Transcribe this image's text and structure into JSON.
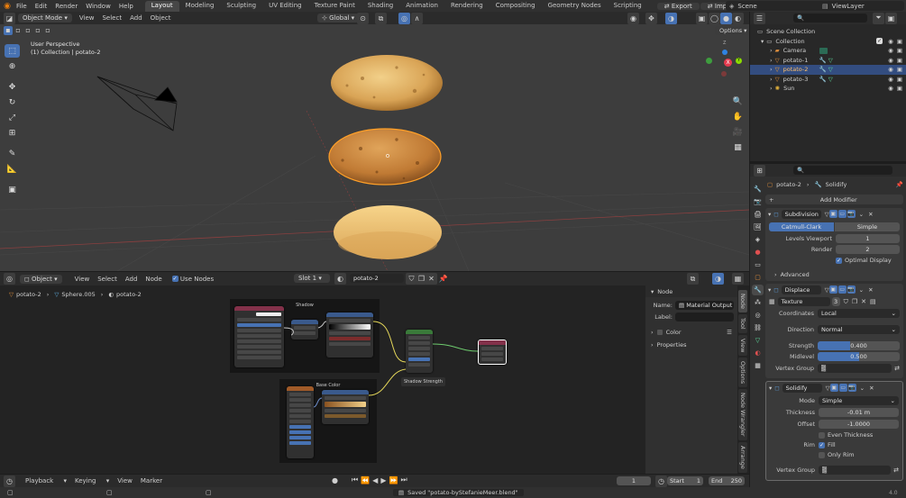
{
  "topbar": {
    "menus": [
      "File",
      "Edit",
      "Render",
      "Window",
      "Help"
    ],
    "workspaces": [
      "Layout",
      "Modeling",
      "Sculpting",
      "UV Editing",
      "Texture Paint",
      "Shading",
      "Animation",
      "Rendering",
      "Compositing",
      "Geometry Nodes",
      "Scripting"
    ],
    "active_workspace": "Layout",
    "export_label": "Export",
    "import_label": "Import",
    "scene": "Scene",
    "view_layer": "ViewLayer"
  },
  "viewport": {
    "mode": "Object Mode",
    "menus": [
      "View",
      "Select",
      "Add",
      "Object"
    ],
    "transform": "Global",
    "overlay_title": "User Perspective",
    "overlay_sub": "(1) Collection | potato-2",
    "options_label": "Options",
    "gizmo_z": "Z",
    "gizmo_x": "X",
    "gizmo_y": "Y"
  },
  "node_editor": {
    "type": "Object",
    "menus": [
      "View",
      "Select",
      "Add",
      "Node"
    ],
    "use_nodes": "Use Nodes",
    "slot": "Slot 1",
    "material": "potato-2",
    "breadcrumb": [
      "potato-2",
      "Sphere.005",
      "potato-2"
    ],
    "frame_shadow": "Shadow",
    "frame_base_color": "Base Color",
    "shadow_strength": "Shadow Strength",
    "side_header": "Node",
    "name_label": "Name:",
    "name_value": "Material Output",
    "label_label": "Label:",
    "color_section": "Color",
    "properties_section": "Properties",
    "vtabs": [
      "Node",
      "Tool",
      "View",
      "Options",
      "Node Wrangler",
      "Arrange"
    ]
  },
  "outliner": {
    "scene_collection": "Scene Collection",
    "collection": "Collection",
    "items": [
      {
        "name": "Camera",
        "color": "#9da26a"
      },
      {
        "name": "potato-1",
        "color": "#e08f3c"
      },
      {
        "name": "potato-2",
        "color": "#e08f3c"
      },
      {
        "name": "potato-3",
        "color": "#e08f3c"
      },
      {
        "name": "Sun",
        "color": "#e0b03c"
      }
    ],
    "selected": "potato-2"
  },
  "properties": {
    "object": "potato-2",
    "modifier_crumb": "Solidify",
    "add_modifier": "Add Modifier",
    "subdivision": {
      "name": "Subdivision",
      "tab_catmull": "Catmull-Clark",
      "tab_simple": "Simple",
      "levels_label": "Levels Viewport",
      "levels_value": "1",
      "render_label": "Render",
      "render_value": "2",
      "optimal_display": "Optimal Display",
      "advanced": "Advanced"
    },
    "displace": {
      "name": "Displace",
      "texture": "Texture",
      "texture_users": "3",
      "coordinates_label": "Coordinates",
      "coordinates_value": "Local",
      "direction_label": "Direction",
      "direction_value": "Normal",
      "strength_label": "Strength",
      "strength_value": "0.400",
      "strength_fraction": 0.4,
      "midlevel_label": "Midlevel",
      "midlevel_value": "0.500",
      "midlevel_fraction": 0.5,
      "vertex_group_label": "Vertex Group"
    },
    "solidify": {
      "name": "Solidify",
      "mode_label": "Mode",
      "mode_value": "Simple",
      "thickness_label": "Thickness",
      "thickness_value": "-0.01 m",
      "offset_label": "Offset",
      "offset_value": "-1.0000",
      "even_thickness": "Even Thickness",
      "rim_label": "Rim",
      "fill_label": "Fill",
      "only_rim": "Only Rim",
      "vertex_group_label": "Vertex Group"
    }
  },
  "timeline": {
    "menus": [
      "Playback",
      "Keying",
      "View",
      "Marker"
    ],
    "current_frame": "1",
    "start_label": "Start",
    "start_value": "1",
    "end_label": "End",
    "end_value": "250"
  },
  "statusbar": {
    "message": "Saved \"potato-byStefanieMeer.blend\"",
    "version": "4.0"
  },
  "colors": {
    "accent": "#4772b3",
    "selection_orange": "#ffa028",
    "potato_light": "#e8b867",
    "potato_dark": "#c07a34"
  }
}
